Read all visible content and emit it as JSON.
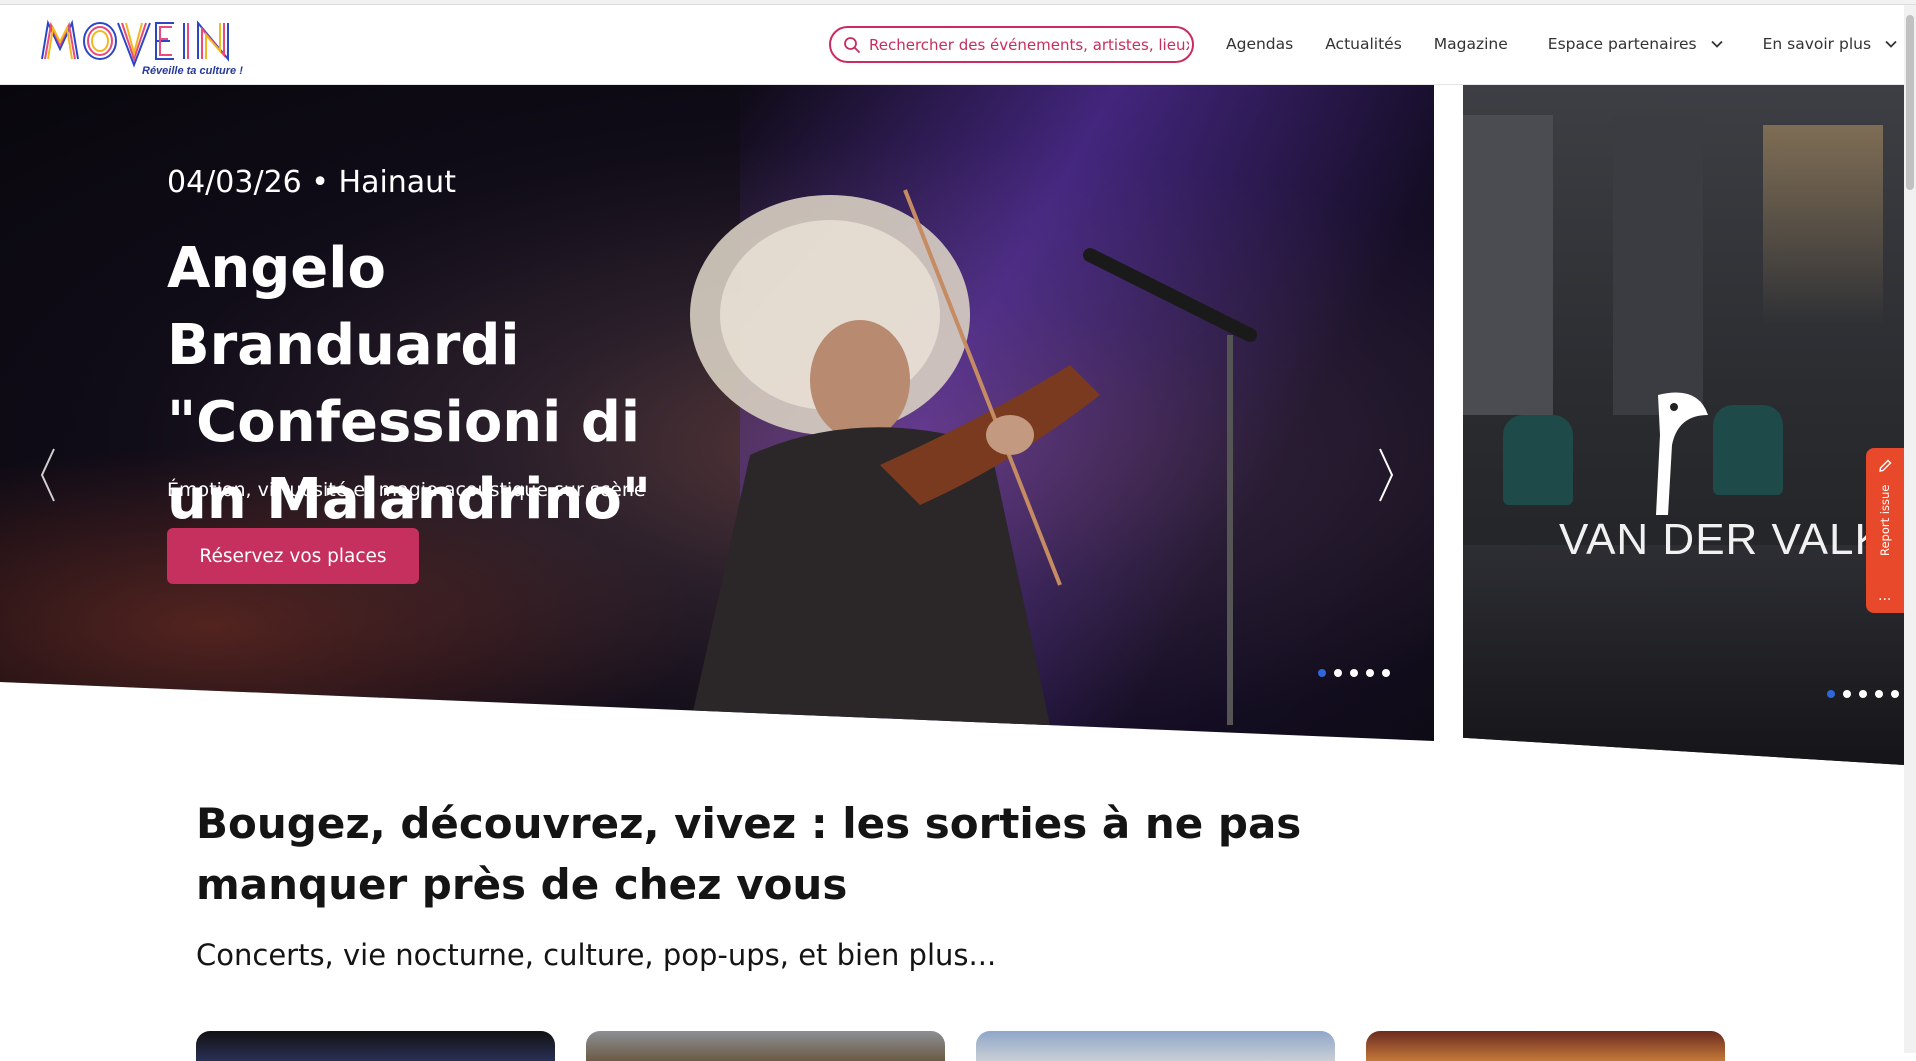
{
  "header": {
    "logo_text": "MOVE IN",
    "logo_tagline": "Réveille ta culture !",
    "search_placeholder": "Rechercher des événements, artistes, lieux...",
    "nav": [
      {
        "label": "Agendas"
      },
      {
        "label": "Actualités"
      },
      {
        "label": "Magazine"
      },
      {
        "label": "Espace partenaires",
        "dropdown": true
      },
      {
        "label": "En savoir plus",
        "dropdown": true
      }
    ]
  },
  "hero": {
    "date_location": "04/03/26 • Hainaut",
    "title": "Angelo Branduardi \"Confessioni di un Malandrino\"",
    "subtitle": "Émotion, virtuosité et magie acoustique sur scène",
    "cta_label": "Réservez vos places",
    "slide_count": 5,
    "active_slide": 1
  },
  "side_banner": {
    "brand": "VAN DER VALK",
    "slide_count": 5,
    "active_slide": 1
  },
  "report_issue": {
    "label": "Report issue",
    "more": "..."
  },
  "section": {
    "title": "Bougez, découvrez, vivez : les sorties à ne pas manquer près de chez vous",
    "subtitle": "Concerts, vie nocturne, culture, pop-ups, et bien plus..."
  },
  "colors": {
    "accent": "#c5305f",
    "active_dot": "#2f66d9",
    "report": "#e8492b"
  },
  "icons": {
    "search": "search-icon",
    "chevron": "chevron-down-icon",
    "prev": "chevron-left-icon",
    "next": "chevron-right-icon",
    "report": "pencil-icon"
  }
}
